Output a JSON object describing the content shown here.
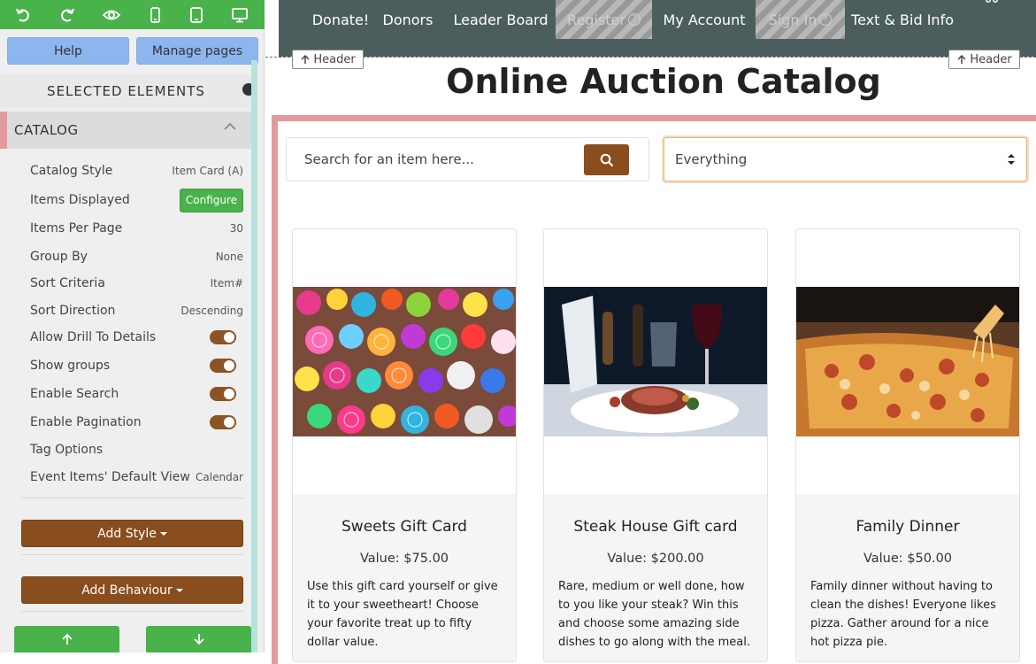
{
  "toolbar": {
    "icons": [
      "undo-icon",
      "redo-icon",
      "eye-icon",
      "phone-icon",
      "tablet-icon",
      "desktop-icon"
    ]
  },
  "left": {
    "help_label": "Help",
    "manage_label": "Manage pages",
    "selected_heading": "SELECTED ELEMENTS",
    "catalog_heading": "CATALOG",
    "rows": [
      {
        "label": "Catalog Style",
        "value": "Item Card (A)"
      },
      {
        "label": "Items Displayed",
        "value": "Configure"
      },
      {
        "label": "Items Per Page",
        "value": "30"
      },
      {
        "label": "Group By",
        "value": "None"
      },
      {
        "label": "Sort Criteria",
        "value": "Item#"
      },
      {
        "label": "Sort Direction",
        "value": "Descending"
      },
      {
        "label": "Allow Drill To Details",
        "value": "on"
      },
      {
        "label": "Show groups",
        "value": "on"
      },
      {
        "label": "Enable Search",
        "value": "on"
      },
      {
        "label": "Enable Pagination",
        "value": "on"
      },
      {
        "label": "Tag Options",
        "value": ""
      },
      {
        "label": "Event Items' Default View",
        "value": "Calendar"
      }
    ],
    "add_style_label": "Add Style",
    "add_behaviour_label": "Add Behaviour"
  },
  "nav": {
    "items": [
      "Donate!",
      "Donors",
      "Leader Board",
      "Register",
      "My Account",
      "Sign In",
      "Text & Bid Info"
    ],
    "question_mark": "?"
  },
  "header_tag_label": "Header",
  "page_title": "Online Auction Catalog",
  "search": {
    "placeholder": "Search for an item here..."
  },
  "filter": {
    "selected": "Everything"
  },
  "cards": [
    {
      "title": "Sweets Gift Card",
      "value": "Value: $75.00",
      "desc": "Use this gift card yourself or give it to your sweetheart! Choose your favorite treat up to fifty dollar value."
    },
    {
      "title": "Steak House Gift card",
      "value": "Value: $200.00",
      "desc": "Rare, medium or well done, how to you like your steak? Win this and choose some amazing side dishes to go along with the meal."
    },
    {
      "title": "Family Dinner",
      "value": "Value: $50.00",
      "desc": "Family dinner without having to clean the dishes! Everyone likes pizza. Gather around for a nice hot pizza pie."
    }
  ],
  "colors": {
    "green": "#49b24a",
    "brown": "#8a4d1d",
    "nav_bg": "#4b5e5d",
    "catalog_border": "#e39a9c"
  }
}
